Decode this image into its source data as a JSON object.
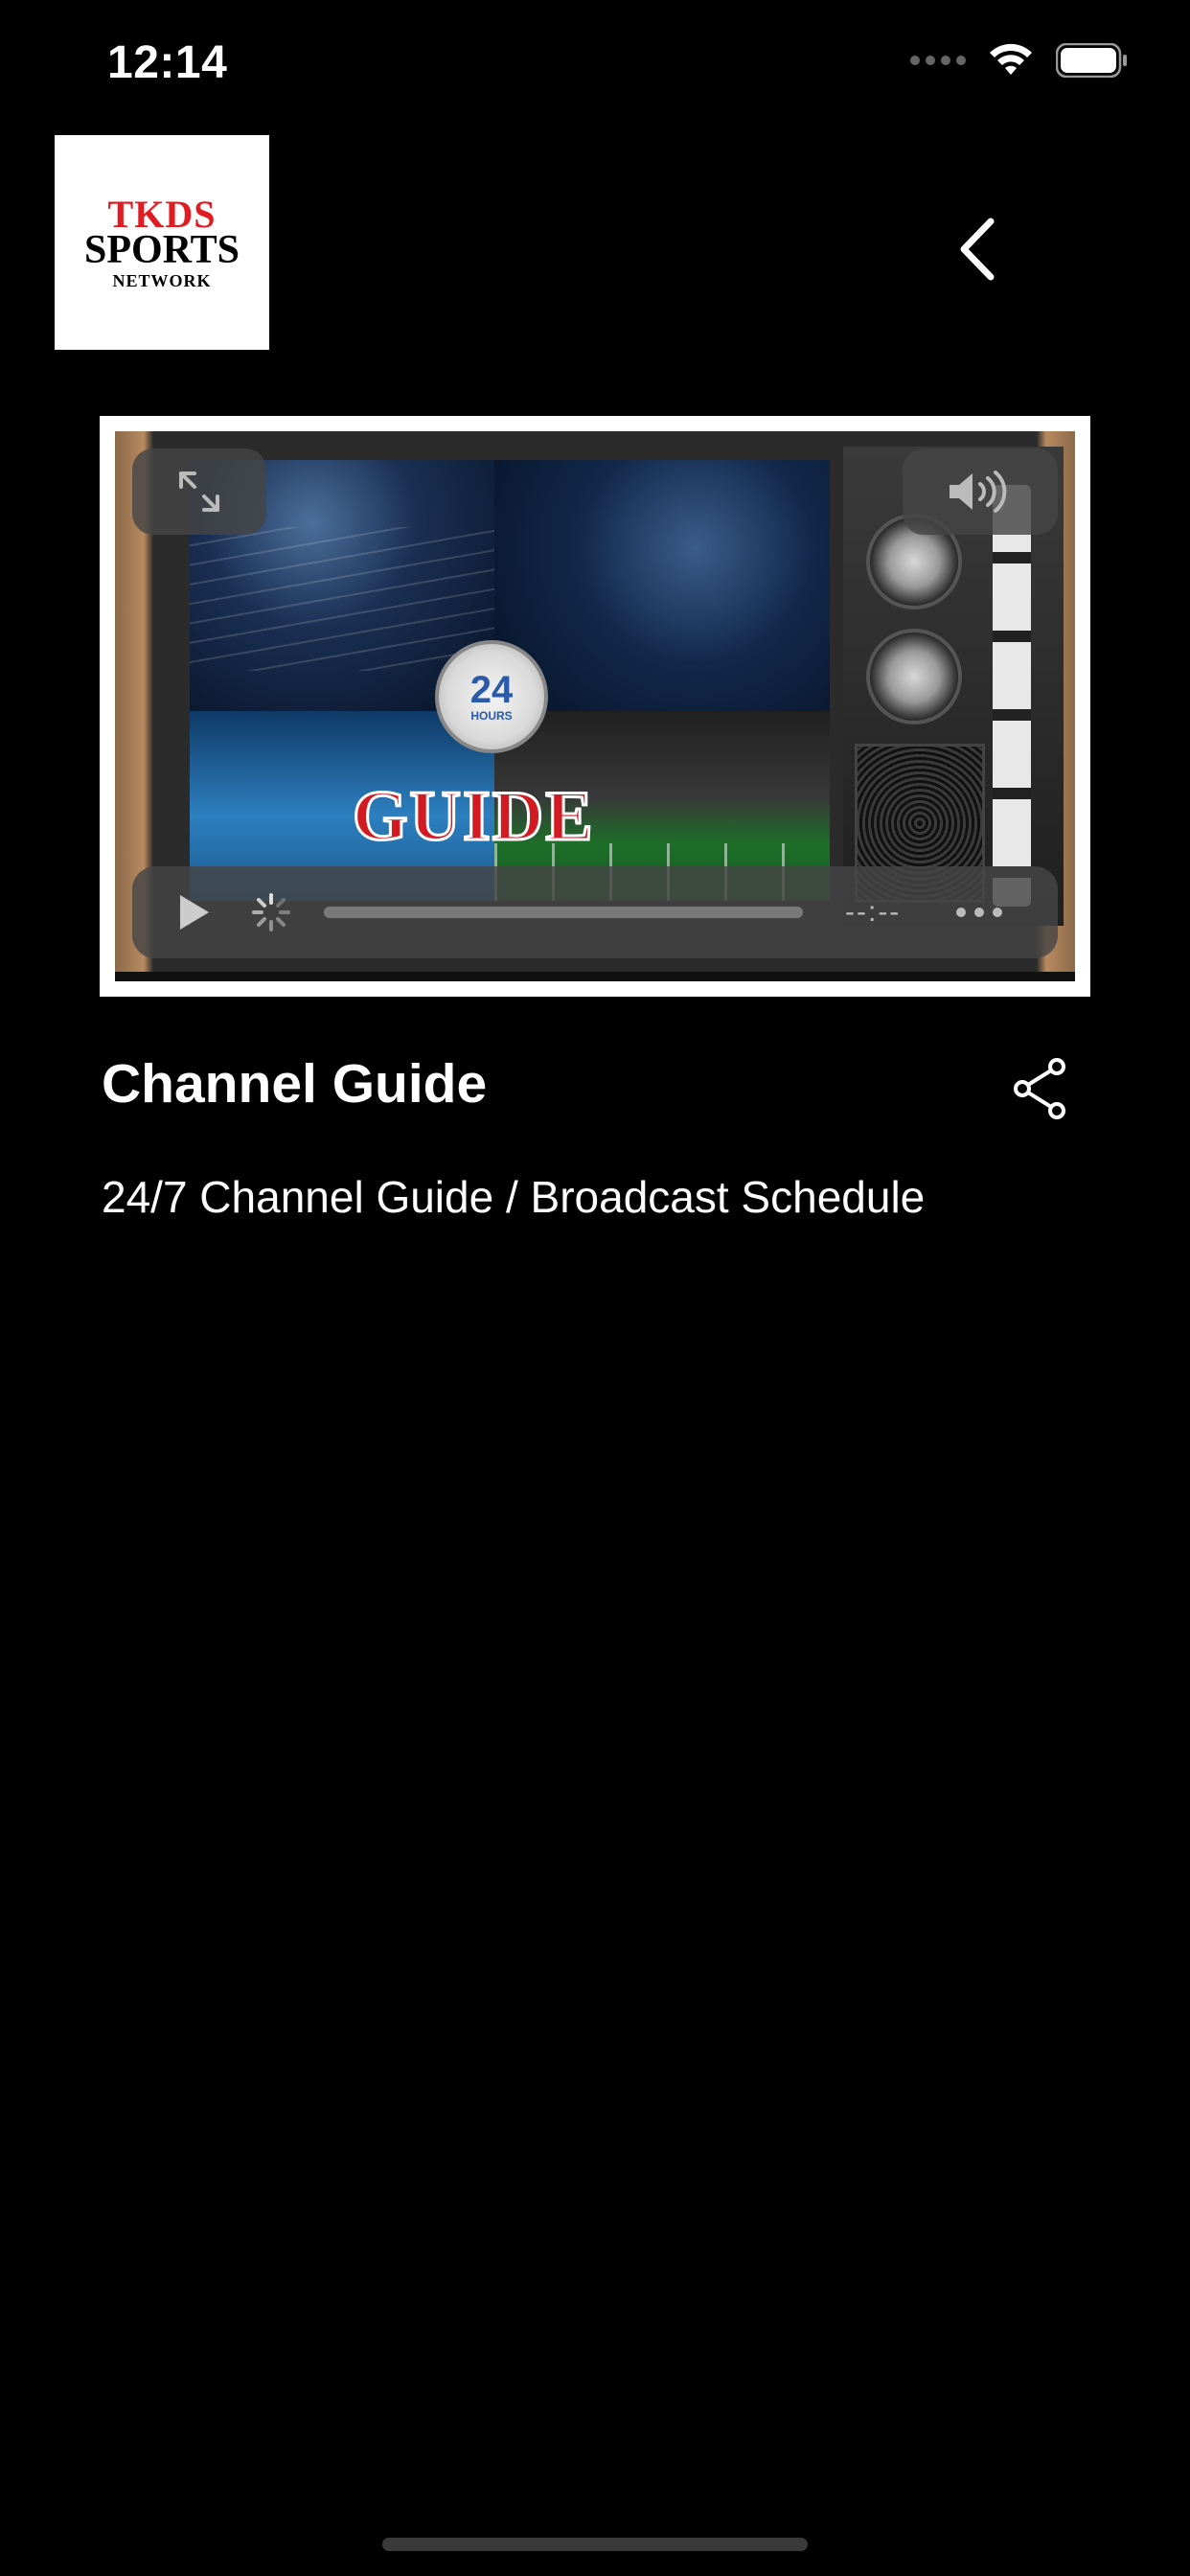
{
  "status_bar": {
    "time": "12:14"
  },
  "header": {
    "logo": {
      "line1": "TKDS",
      "line2": "SPORTS",
      "line3": "NETWORK"
    },
    "back_icon": "chevron-left-icon"
  },
  "video": {
    "thumbnail": {
      "clock_number": "24",
      "clock_label": "HOURS",
      "overlay_word": "GUIDE"
    },
    "fullscreen_icon": "expand-icon",
    "volume_icon": "speaker-icon",
    "play_icon": "play-icon",
    "loading_icon": "spinner-icon",
    "time_display": "--:--",
    "more_icon": "more-icon"
  },
  "content": {
    "title": "Channel Guide",
    "description": "24/7 Channel Guide / Broadcast Schedule",
    "share_icon": "share-icon"
  },
  "colors": {
    "background": "#000000",
    "text": "#ffffff",
    "logo_red": "#e11b22"
  }
}
